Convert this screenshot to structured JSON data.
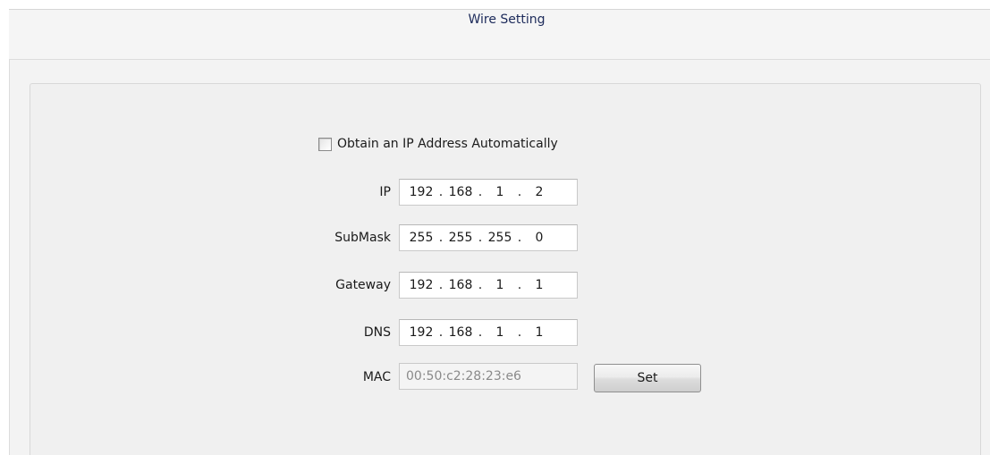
{
  "header": {
    "title": "Wire Setting"
  },
  "dhcp_checkbox": {
    "label": "Obtain an IP Address Automatically",
    "checked": false
  },
  "fields": {
    "ip": {
      "label": "IP",
      "octets": [
        "192",
        "168",
        "1",
        "2"
      ]
    },
    "submask": {
      "label": "SubMask",
      "octets": [
        "255",
        "255",
        "255",
        "0"
      ]
    },
    "gateway": {
      "label": "Gateway",
      "octets": [
        "192",
        "168",
        "1",
        "1"
      ]
    },
    "dns": {
      "label": "DNS",
      "octets": [
        "192",
        "168",
        "1",
        "1"
      ]
    }
  },
  "mac": {
    "label": "MAC",
    "value": "00:50:c2:28:23:e6"
  },
  "set_button": {
    "label": "Set"
  },
  "separators": {
    "dot": "."
  }
}
